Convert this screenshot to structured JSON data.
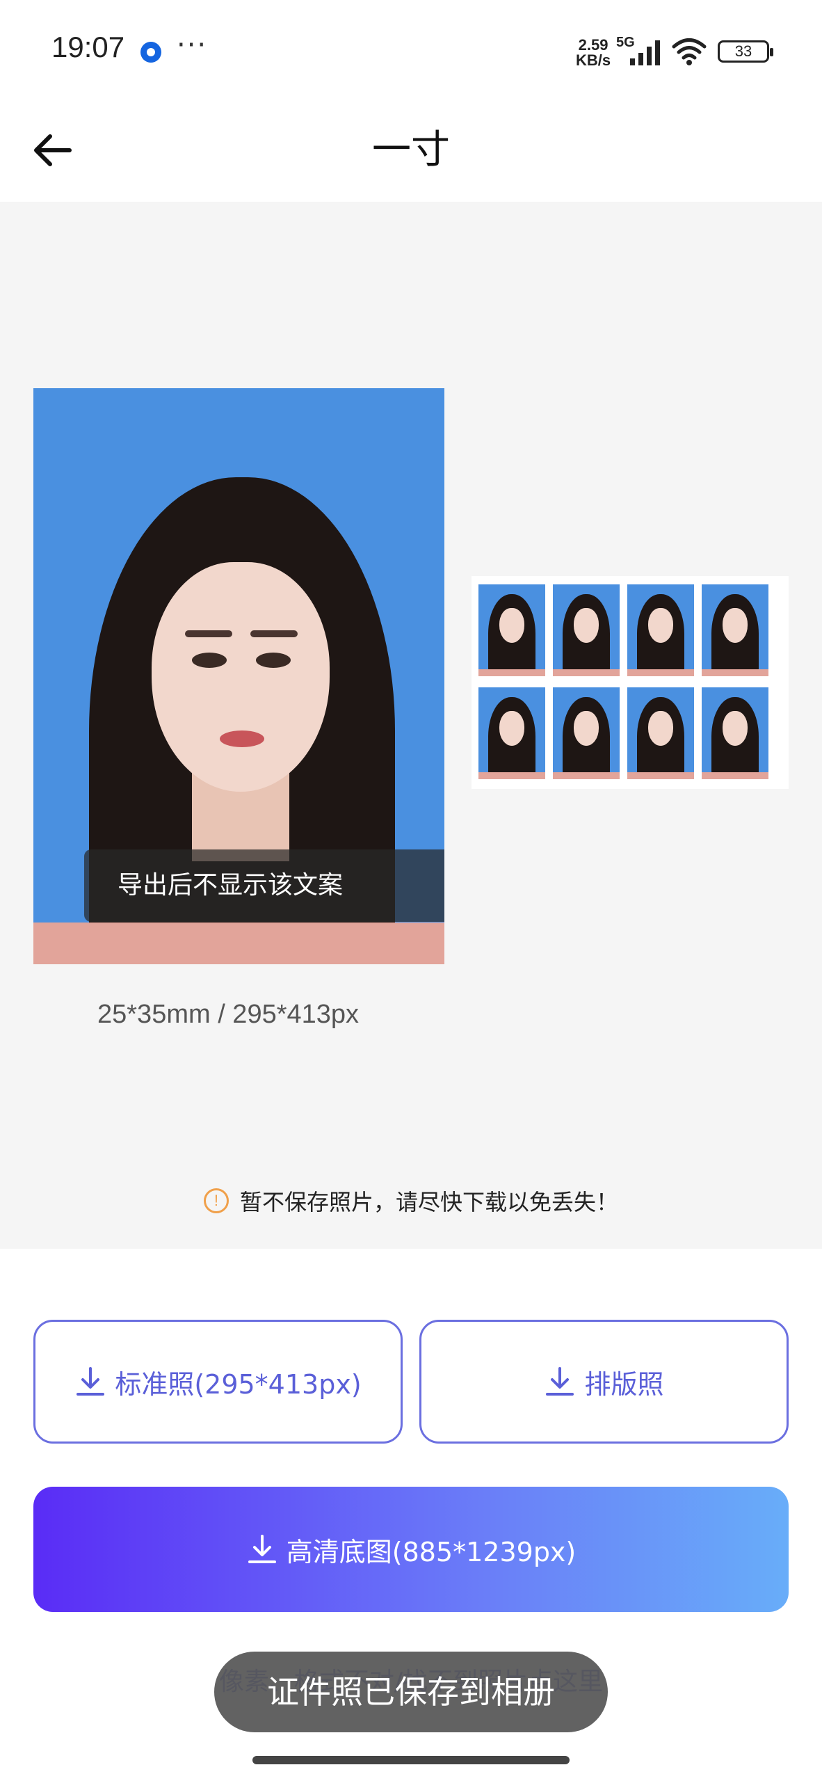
{
  "status_bar": {
    "time": "19:07",
    "net_speed_value": "2.59",
    "net_speed_unit": "KB/s",
    "network": "5G",
    "battery": "33",
    "icons": [
      "app-notification-icon",
      "more-dots-icon",
      "signal-icon",
      "wifi-icon",
      "battery-icon"
    ]
  },
  "header": {
    "title": "一寸",
    "back_icon": "back-arrow-icon"
  },
  "preview": {
    "watermark": "导出后不显示该文案",
    "size_info": "25*35mm / 295*413px",
    "background_color": "#4a90e0",
    "layout_count": 8
  },
  "notice": {
    "icon": "info-icon",
    "text": "暂不保存照片，请尽快下载以免丢失！"
  },
  "buttons": {
    "standard": "标准照(295*413px)",
    "layout": "排版照",
    "hd": "高清底图(885*1239px)"
  },
  "bottom_link": "像素、格式不对/找不到照片点这里",
  "toast": "证件照已保存到相册",
  "colors": {
    "accent": "#6b6fe0",
    "gradient_start": "#5a2cf6",
    "gradient_end": "#68adf9",
    "notice_icon": "#f0a04a"
  }
}
